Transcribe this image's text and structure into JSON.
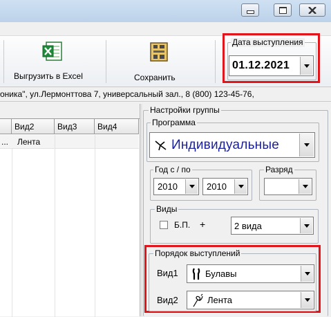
{
  "window": {
    "minimize_icon": "minimize-icon",
    "maximize_icon": "maximize-icon",
    "close_icon": "close-icon"
  },
  "toolbar": {
    "export_label": "Выгрузить в Excel",
    "save_label": "Сохранить"
  },
  "performance_date": {
    "legend": "Дата выступления",
    "value": "01.12.2021"
  },
  "address_line": "оника\", ул.Лермонттова 7, универсальный зал., 8 (800) 123-45-76,",
  "grid": {
    "columns": [
      "Вид2",
      "Вид3",
      "Вид4"
    ],
    "rows": [
      [
        "...",
        "Лента",
        "",
        ""
      ]
    ]
  },
  "group_settings": {
    "legend": "Настройки группы",
    "program": {
      "legend": "Программа",
      "value": "Индивидуальные"
    },
    "year": {
      "legend": "Год с / по",
      "from": "2010",
      "to": "2010"
    },
    "rank": {
      "legend": "Разряд",
      "value": ""
    },
    "kinds": {
      "legend": "Виды",
      "bp_label": "Б.П.",
      "plus": "+",
      "count_value": "2 вида"
    },
    "order": {
      "legend": "Порядок выступлений",
      "kind1_label": "Вид1",
      "kind1_value": "Булавы",
      "kind2_label": "Вид2",
      "kind2_value": "Лента"
    }
  },
  "colors": {
    "highlight": "#e0161c",
    "program_text": "#1a1f9c"
  }
}
